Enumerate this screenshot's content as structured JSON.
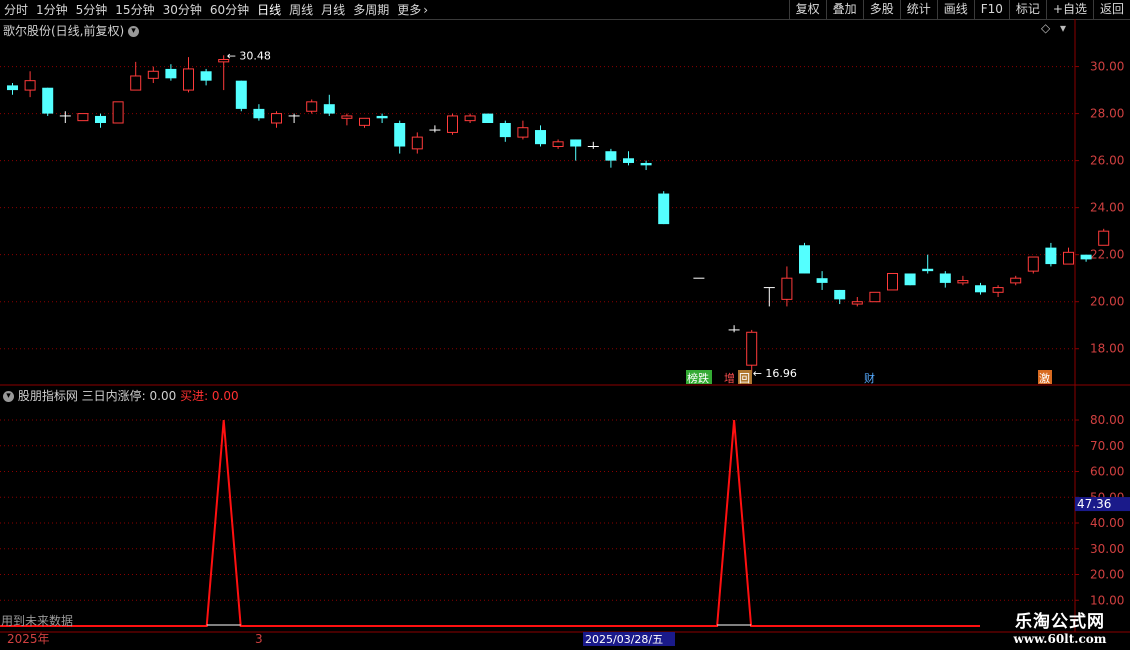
{
  "toolbar": {
    "periods": [
      "分时",
      "1分钟",
      "5分钟",
      "15分钟",
      "30分钟",
      "60分钟",
      "日线",
      "周线",
      "月线",
      "多周期",
      "更多"
    ],
    "active_period": "日线",
    "more_chevron": "›",
    "actions": [
      "复权",
      "叠加",
      "多股",
      "统计",
      "画线",
      "F10",
      "标记",
      "+自选",
      "返回"
    ]
  },
  "main_pane": {
    "title": "歌尔股份(日线,前复权)",
    "dropdown_glyph": "▾",
    "diamond_glyph": "◇",
    "high_label": "30.48",
    "low_label": "16.96",
    "tags": [
      "榜跌",
      "增",
      "回",
      "财",
      "激"
    ],
    "y_ticks": [
      "30.00",
      "28.00",
      "26.00",
      "24.00",
      "22.00",
      "20.00",
      "18.00"
    ]
  },
  "indicator_pane": {
    "name": "股朋指标网",
    "param_text": "三日内涨停: 0.00",
    "buy_text": "买进: 0.00",
    "y_ticks": [
      "80.00",
      "70.00",
      "60.00",
      "50.00",
      "40.00",
      "30.00",
      "20.00",
      "10.00"
    ],
    "current_value": "47.36",
    "future_warning": "用到未来数据"
  },
  "time_axis": {
    "year_label": "2025年",
    "month_label": "3",
    "date_cursor": "2025/03/28/五"
  },
  "watermark": {
    "line1": "乐淘公式网",
    "line2": "www.60lt.com"
  },
  "colors": {
    "up": "#ff3b3b",
    "down": "#54ffff",
    "grid": "#8b0000",
    "axis_text": "#d04040",
    "indicator": "#ff1010"
  },
  "chart_data": {
    "type": "candlestick",
    "ylim": [
      16.5,
      31.3
    ],
    "candles": [
      {
        "o": 29.2,
        "h": 29.3,
        "l": 28.8,
        "c": 29.0
      },
      {
        "o": 29.0,
        "h": 29.8,
        "l": 28.7,
        "c": 29.4
      },
      {
        "o": 29.1,
        "h": 29.1,
        "l": 27.9,
        "c": 28.0
      },
      {
        "o": 27.9,
        "h": 28.1,
        "l": 27.6,
        "c": 27.9
      },
      {
        "o": 27.7,
        "h": 28.0,
        "l": 27.7,
        "c": 28.0
      },
      {
        "o": 27.9,
        "h": 28.0,
        "l": 27.4,
        "c": 27.6
      },
      {
        "o": 27.6,
        "h": 28.5,
        "l": 27.6,
        "c": 28.5
      },
      {
        "o": 29.0,
        "h": 30.2,
        "l": 29.0,
        "c": 29.6
      },
      {
        "o": 29.5,
        "h": 30.0,
        "l": 29.3,
        "c": 29.8
      },
      {
        "o": 29.9,
        "h": 30.1,
        "l": 29.4,
        "c": 29.5
      },
      {
        "o": 29.0,
        "h": 30.4,
        "l": 28.9,
        "c": 29.9
      },
      {
        "o": 29.8,
        "h": 29.9,
        "l": 29.2,
        "c": 29.4
      },
      {
        "o": 30.2,
        "h": 30.48,
        "l": 29.0,
        "c": 30.3
      },
      {
        "o": 29.4,
        "h": 29.4,
        "l": 28.1,
        "c": 28.2
      },
      {
        "o": 28.2,
        "h": 28.4,
        "l": 27.7,
        "c": 27.8
      },
      {
        "o": 27.6,
        "h": 28.1,
        "l": 27.4,
        "c": 28.0
      },
      {
        "o": 27.9,
        "h": 28.0,
        "l": 27.6,
        "c": 27.9
      },
      {
        "o": 28.1,
        "h": 28.6,
        "l": 28.0,
        "c": 28.5
      },
      {
        "o": 28.4,
        "h": 28.8,
        "l": 27.9,
        "c": 28.0
      },
      {
        "o": 27.8,
        "h": 28.0,
        "l": 27.5,
        "c": 27.9
      },
      {
        "o": 27.5,
        "h": 27.8,
        "l": 27.4,
        "c": 27.8
      },
      {
        "o": 27.9,
        "h": 28.0,
        "l": 27.6,
        "c": 27.8
      },
      {
        "o": 27.6,
        "h": 27.7,
        "l": 26.3,
        "c": 26.6
      },
      {
        "o": 26.5,
        "h": 27.2,
        "l": 26.3,
        "c": 27.0
      },
      {
        "o": 27.3,
        "h": 27.5,
        "l": 27.2,
        "c": 27.3
      },
      {
        "o": 27.2,
        "h": 28.0,
        "l": 27.1,
        "c": 27.9
      },
      {
        "o": 27.7,
        "h": 28.0,
        "l": 27.6,
        "c": 27.9
      },
      {
        "o": 28.0,
        "h": 28.0,
        "l": 27.6,
        "c": 27.6
      },
      {
        "o": 27.6,
        "h": 27.7,
        "l": 26.8,
        "c": 27.0
      },
      {
        "o": 27.0,
        "h": 27.7,
        "l": 26.9,
        "c": 27.4
      },
      {
        "o": 27.3,
        "h": 27.5,
        "l": 26.6,
        "c": 26.7
      },
      {
        "o": 26.6,
        "h": 26.9,
        "l": 26.5,
        "c": 26.8
      },
      {
        "o": 26.9,
        "h": 26.9,
        "l": 26.0,
        "c": 26.6
      },
      {
        "o": 26.6,
        "h": 26.8,
        "l": 26.5,
        "c": 26.6
      },
      {
        "o": 26.4,
        "h": 26.5,
        "l": 25.7,
        "c": 26.0
      },
      {
        "o": 26.1,
        "h": 26.4,
        "l": 25.8,
        "c": 25.9
      },
      {
        "o": 25.9,
        "h": 26.0,
        "l": 25.6,
        "c": 25.8
      },
      {
        "o": 24.6,
        "h": 24.7,
        "l": 23.3,
        "c": 23.3
      },
      null,
      {
        "o": 21.0,
        "h": 21.0,
        "l": 21.0,
        "c": 21.0
      },
      null,
      {
        "o": 18.8,
        "h": 19.0,
        "l": 18.7,
        "c": 18.8
      },
      {
        "o": 17.3,
        "h": 18.8,
        "l": 16.96,
        "c": 18.7
      },
      {
        "o": 20.6,
        "h": 20.6,
        "l": 19.8,
        "c": 20.6
      },
      {
        "o": 20.1,
        "h": 21.5,
        "l": 19.8,
        "c": 21.0
      },
      {
        "o": 22.4,
        "h": 22.5,
        "l": 21.2,
        "c": 21.2
      },
      {
        "o": 21.0,
        "h": 21.3,
        "l": 20.5,
        "c": 20.8
      },
      {
        "o": 20.5,
        "h": 20.5,
        "l": 19.9,
        "c": 20.1
      },
      {
        "o": 19.9,
        "h": 20.2,
        "l": 19.8,
        "c": 20.0
      },
      {
        "o": 20.0,
        "h": 20.4,
        "l": 20.0,
        "c": 20.4
      },
      {
        "o": 20.5,
        "h": 21.2,
        "l": 20.5,
        "c": 21.2
      },
      {
        "o": 21.2,
        "h": 21.2,
        "l": 20.7,
        "c": 20.7
      },
      {
        "o": 21.4,
        "h": 22.0,
        "l": 21.2,
        "c": 21.3
      },
      {
        "o": 21.2,
        "h": 21.3,
        "l": 20.6,
        "c": 20.8
      },
      {
        "o": 20.8,
        "h": 21.1,
        "l": 20.7,
        "c": 20.9
      },
      {
        "o": 20.7,
        "h": 20.8,
        "l": 20.3,
        "c": 20.4
      },
      {
        "o": 20.4,
        "h": 20.7,
        "l": 20.2,
        "c": 20.6
      },
      {
        "o": 20.8,
        "h": 21.1,
        "l": 20.7,
        "c": 21.0
      },
      {
        "o": 21.3,
        "h": 21.9,
        "l": 21.2,
        "c": 21.9
      },
      {
        "o": 22.3,
        "h": 22.5,
        "l": 21.5,
        "c": 21.6
      },
      {
        "o": 21.6,
        "h": 22.3,
        "l": 21.6,
        "c": 22.1
      },
      {
        "o": 22.0,
        "h": 22.0,
        "l": 21.7,
        "c": 21.8
      },
      {
        "o": 22.4,
        "h": 23.1,
        "l": 22.4,
        "c": 23.0
      }
    ],
    "indicator": {
      "ylim": [
        0,
        87
      ],
      "baseline": 0,
      "spikes": [
        {
          "index": 12,
          "value": 80
        },
        {
          "index": 41,
          "value": 80
        }
      ]
    }
  }
}
